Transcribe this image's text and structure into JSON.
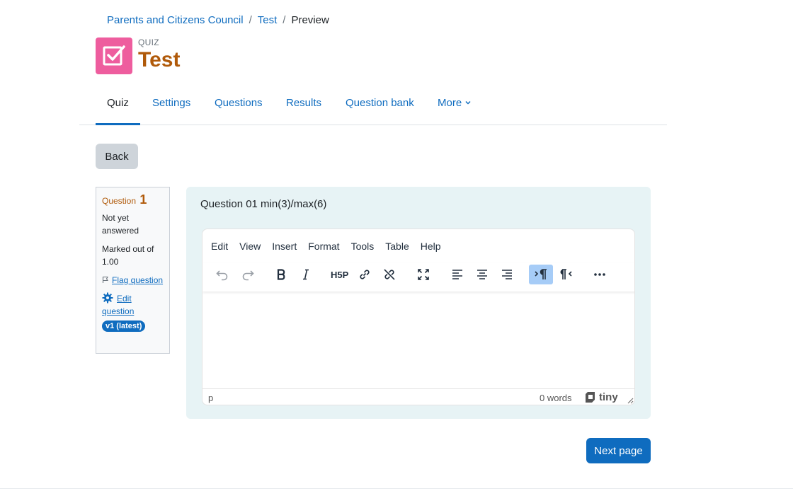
{
  "breadcrumb": {
    "items": [
      "Parents and Citizens Council",
      "Test"
    ],
    "current": "Preview"
  },
  "header": {
    "activity_type": "QUIZ",
    "title": "Test",
    "icon": "quiz-checkbox-icon",
    "icon_color": "#ee5d9e"
  },
  "nav": {
    "tabs": [
      {
        "label": "Quiz",
        "active": true
      },
      {
        "label": "Settings",
        "active": false
      },
      {
        "label": "Questions",
        "active": false
      },
      {
        "label": "Results",
        "active": false
      },
      {
        "label": "Question bank",
        "active": false
      },
      {
        "label": "More",
        "active": false
      }
    ]
  },
  "back_label": "Back",
  "question_info": {
    "question_word": "Question",
    "number": "1",
    "state": "Not yet answered",
    "grade": "Marked out of 1.00",
    "flag_label": "Flag question",
    "edit_label": "Edit question",
    "version_badge": "v1 (latest)"
  },
  "question": {
    "text": "Question 01 min(3)/max(6)"
  },
  "editor": {
    "menu": [
      "Edit",
      "View",
      "Insert",
      "Format",
      "Tools",
      "Table",
      "Help"
    ],
    "toolbar": [
      "undo-icon",
      "redo-icon",
      "bold-icon",
      "italic-icon",
      "h5p-icon",
      "link-icon",
      "unlink-icon",
      "fullscreen-icon",
      "align-left-icon",
      "align-center-icon",
      "align-right-icon",
      "ltr-icon",
      "rtl-icon",
      "more-icon"
    ],
    "status_path": "p",
    "word_count": "0 words",
    "brand": "tiny"
  },
  "next_label": "Next page",
  "colors": {
    "link": "#0f6cbf",
    "title": "#b05a0a",
    "question_bg": "#e7f3f5"
  }
}
